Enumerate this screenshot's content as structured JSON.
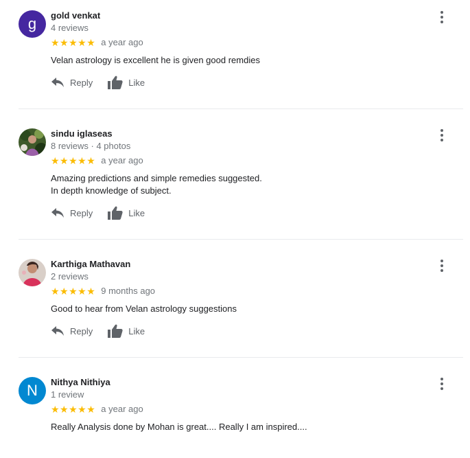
{
  "reviews": [
    {
      "name": "gold venkat",
      "meta": "4 reviews",
      "avatar_letter": "g",
      "avatar_color": "#4527a0",
      "stars": "★★★★★",
      "date": "a year ago",
      "text_lines": [
        "Velan astrology is excellent  he is given good remdies"
      ],
      "reply_label": "Reply",
      "like_label": "Like"
    },
    {
      "name": "sindu iglaseas",
      "meta": "8 reviews · 4 photos",
      "avatar_letter": "",
      "stars": "★★★★★",
      "date": "a year ago",
      "text_lines": [
        "Amazing predictions and simple remedies suggested.",
        "In depth knowledge of subject."
      ],
      "reply_label": "Reply",
      "like_label": "Like"
    },
    {
      "name": "Karthiga Mathavan",
      "meta": "2 reviews",
      "avatar_letter": "",
      "stars": "★★★★★",
      "date": "9 months ago",
      "text_lines": [
        "Good to hear from Velan astrology suggestions"
      ],
      "reply_label": "Reply",
      "like_label": "Like"
    },
    {
      "name": "Nithya Nithiya",
      "meta": "1 review",
      "avatar_letter": "N",
      "avatar_color": "#0288d1",
      "stars": "★★★★★",
      "date": "a year ago",
      "text_lines": [
        "Really Analysis done by Mohan is great.... Really I am inspired...."
      ],
      "reply_label": "Reply",
      "like_label": "Like"
    }
  ],
  "colors": {
    "star": "#fbbc04",
    "muted": "#70757a",
    "icon": "#5f6368"
  }
}
